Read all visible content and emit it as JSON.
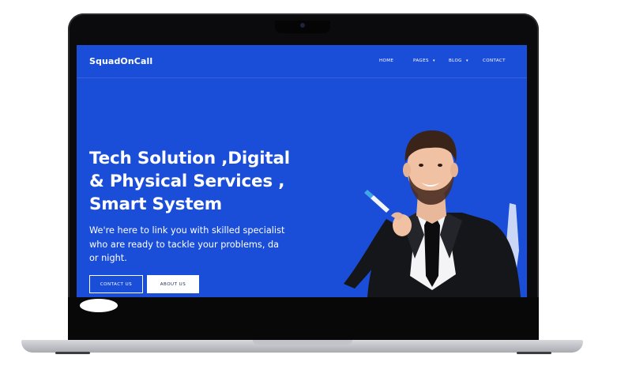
{
  "site": {
    "brand": "SquadOnCall",
    "nav": [
      {
        "label": "HOME",
        "has_dropdown": false
      },
      {
        "label": "PAGES",
        "has_dropdown": true
      },
      {
        "label": "BLOG",
        "has_dropdown": true
      },
      {
        "label": "CONTACT",
        "has_dropdown": false
      }
    ]
  },
  "hero": {
    "title_lines": [
      "Tech Solution ,Digital",
      "& Physical Services ,",
      "Smart System"
    ],
    "subtitle_lines": [
      "We're here to link you with skilled specialist",
      "who are ready to tackle your problems, da",
      "or night."
    ],
    "buttons": {
      "contact": "CONTACT US",
      "about": "ABOUT US"
    }
  },
  "icons": {
    "dropdown": "chevron-down-icon"
  },
  "colors": {
    "hero_bg": "#1b4ed8",
    "text": "#ffffff",
    "laptop_frame": "#0b0b0d",
    "laptop_base": "#c2c4c9"
  }
}
